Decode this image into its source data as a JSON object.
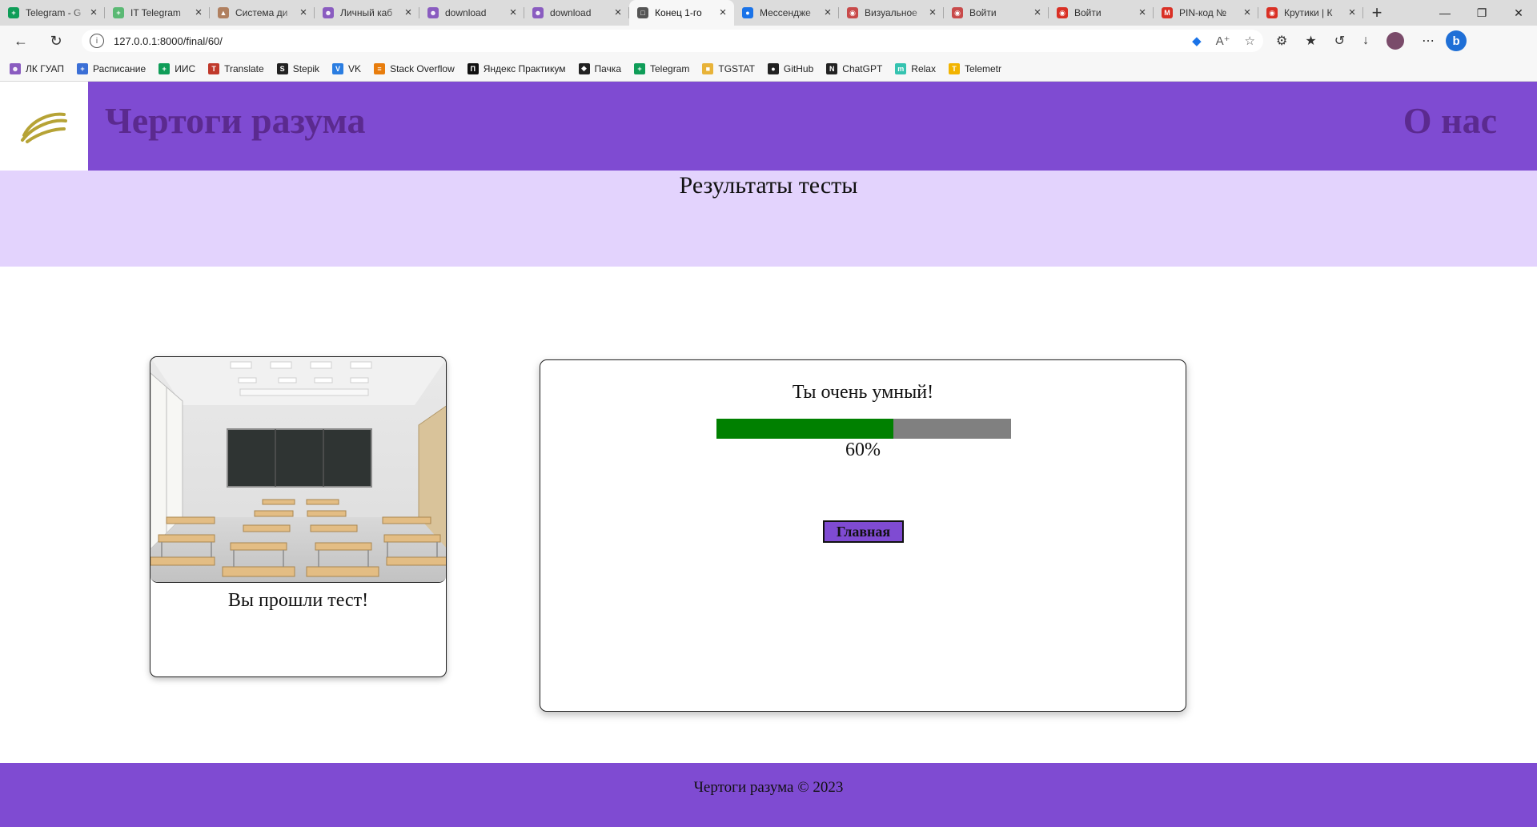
{
  "browser": {
    "tabs": [
      {
        "title": "Telegram - G",
        "icon": "sheets-icon",
        "color": "#0f9d58",
        "active": false
      },
      {
        "title": "IT Telegram",
        "icon": "sheets-icon",
        "color": "#5bb974",
        "active": false
      },
      {
        "title": "Система ди",
        "icon": "system-icon",
        "color": "#b08060",
        "active": false
      },
      {
        "title": "Личный каб",
        "icon": "user-icon",
        "color": "#8a5cc0",
        "active": false
      },
      {
        "title": "download",
        "icon": "user-icon",
        "color": "#8a5cc0",
        "active": false
      },
      {
        "title": "download",
        "icon": "user-icon",
        "color": "#8a5cc0",
        "active": false
      },
      {
        "title": "Конец 1-го",
        "icon": "page-icon",
        "color": "#555555",
        "active": true
      },
      {
        "title": "Мессендже",
        "icon": "chat-icon",
        "color": "#1a73e8",
        "active": false
      },
      {
        "title": "Визуальное",
        "icon": "circle-icon",
        "color": "#c84a4a",
        "active": false
      },
      {
        "title": "Войти",
        "icon": "circle-icon",
        "color": "#c84a4a",
        "active": false
      },
      {
        "title": "Войти",
        "icon": "target-icon",
        "color": "#d93025",
        "active": false
      },
      {
        "title": "PIN-код №",
        "icon": "gmail-icon",
        "color": "#d93025",
        "active": false
      },
      {
        "title": "Крутики | К",
        "icon": "target-icon",
        "color": "#d93025",
        "active": false
      }
    ],
    "url": "127.0.0.1:8000/final/60/",
    "bookmarks": [
      {
        "label": "ЛК ГУАП",
        "icon": "user-icon",
        "color": "#8a5cc0"
      },
      {
        "label": "Расписание",
        "icon": "cross-icon",
        "color": "#3b6fd6"
      },
      {
        "label": "ИИС",
        "icon": "sheets-icon",
        "color": "#0f9d58"
      },
      {
        "label": "Translate",
        "icon": "translate-icon",
        "color": "#c0392b"
      },
      {
        "label": "Stepik",
        "icon": "stepik-icon",
        "color": "#222222"
      },
      {
        "label": "VK",
        "icon": "vk-icon",
        "color": "#2a7de1"
      },
      {
        "label": "Stack Overflow",
        "icon": "stackoverflow-icon",
        "color": "#e87d0d"
      },
      {
        "label": "Яндекс Практикум",
        "icon": "practicum-icon",
        "color": "#111111"
      },
      {
        "label": "Пачка",
        "icon": "pachka-icon",
        "color": "#222222"
      },
      {
        "label": "Telegram",
        "icon": "sheets-icon",
        "color": "#0f9d58"
      },
      {
        "label": "TGSTAT",
        "icon": "folder-icon",
        "color": "#e8b339"
      },
      {
        "label": "GitHub",
        "icon": "github-icon",
        "color": "#222222"
      },
      {
        "label": "ChatGPT",
        "icon": "notion-icon",
        "color": "#222222"
      },
      {
        "label": "Relax",
        "icon": "relax-icon",
        "color": "#35c3b0"
      },
      {
        "label": "Telemetr",
        "icon": "telemetr-icon",
        "color": "#f2b400"
      }
    ]
  },
  "site": {
    "title": "Чертоги разума",
    "about_link": "О нас",
    "results_heading": "Результаты тесты",
    "card_caption": "Вы прошли тест!",
    "result_message": "Ты очень умный!",
    "progress_percent": 60,
    "progress_label": "60%",
    "home_button": "Главная",
    "footer": "Чертоги разума © 2023",
    "colors": {
      "header": "#7f4bd2",
      "band": "#e3d3fd",
      "title": "#5b2a8f",
      "progress_fill": "#008000",
      "progress_track": "#808080",
      "logo": "#b6a336"
    }
  }
}
